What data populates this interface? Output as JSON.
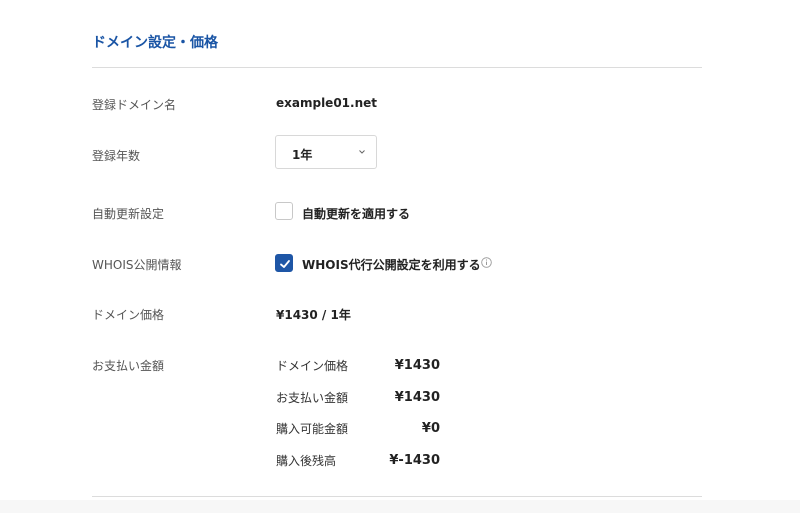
{
  "section": {
    "title": "ドメイン設定・価格"
  },
  "rows": {
    "domain_name": {
      "label": "登録ドメイン名",
      "value": "example01.net"
    },
    "years": {
      "label": "登録年数",
      "selected": "1年"
    },
    "auto_renew": {
      "label": "自動更新設定",
      "checkbox_label": "自動更新を適用する",
      "checked": false
    },
    "whois": {
      "label": "WHOIS公開情報",
      "checkbox_label": "WHOIS代行公開設定を利用する",
      "checked": true
    },
    "price": {
      "label": "ドメイン価格",
      "value": "¥1430 / 1年"
    },
    "payment": {
      "label": "お支払い金額",
      "items": [
        {
          "label": "ドメイン価格",
          "amount": "¥1430"
        },
        {
          "label": "お支払い金額",
          "amount": "¥1430"
        },
        {
          "label": "購入可能金額",
          "amount": "¥0"
        },
        {
          "label": "購入後残高",
          "amount": "¥-1430"
        }
      ]
    }
  },
  "colors": {
    "accent": "#1a55a5",
    "checkbox_checked": "#1e56a6",
    "divider": "#dcdcdc"
  },
  "icons": {
    "select_chevron": "chevron-down-icon",
    "checkmark": "check-icon",
    "info": "info-icon"
  }
}
